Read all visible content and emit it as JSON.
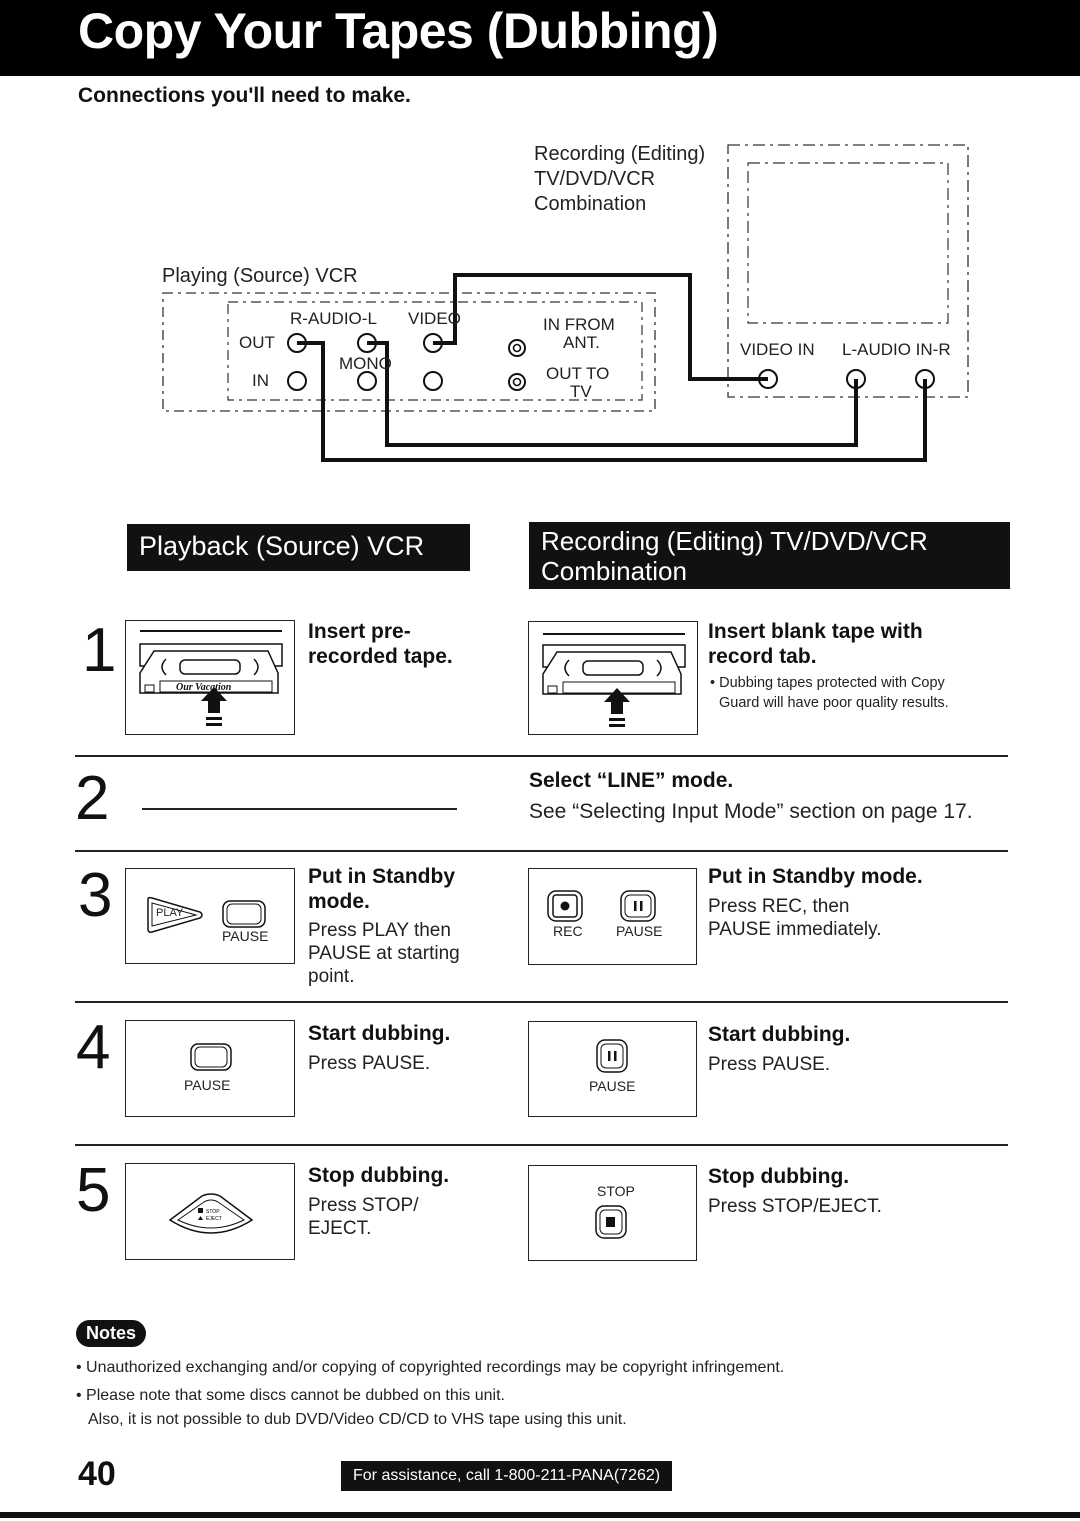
{
  "header": {
    "title": "Copy Your Tapes (Dubbing)",
    "subtitle": "Connections you'll need to make."
  },
  "diagram": {
    "source_device_label": "Playing (Source) VCR",
    "target_device_label_lines": [
      "Recording (Editing)",
      "TV/DVD/VCR",
      "Combination"
    ],
    "source_jacks": {
      "audio_label": "R-AUDIO-L",
      "video_label": "VIDEO",
      "out_label": "OUT",
      "in_label": "IN",
      "mono_label": "MONO",
      "in_from_label": "IN FROM",
      "ant_label": "ANT.",
      "out_to_label": "OUT TO",
      "tv_label": "TV"
    },
    "target_jacks": {
      "video_in_label": "VIDEO IN",
      "audio_in_label": "L-AUDIO IN-R"
    }
  },
  "columns": {
    "left_heading": "Playback (Source) VCR",
    "right_heading_lines": [
      "Recording (Editing) TV/DVD/VCR",
      "Combination"
    ]
  },
  "steps": [
    {
      "number": "1",
      "left": {
        "heading": "Insert pre-\nrecorded tape.",
        "heading_lines": [
          "Insert pre-",
          "recorded tape."
        ],
        "tape_label": "Our Vacation"
      },
      "right": {
        "heading_lines": [
          "Insert blank tape with",
          "record tab."
        ],
        "bullet_lines": [
          "• Dubbing tapes protected with Copy",
          "  Guard will have poor quality results."
        ]
      }
    },
    {
      "number": "2",
      "right": {
        "heading": "Select “LINE” mode.",
        "text": "See “Selecting Input Mode” section on page 17."
      }
    },
    {
      "number": "3",
      "left": {
        "heading_lines": [
          "Put in Standby",
          "mode."
        ],
        "text_lines": [
          "Press PLAY then",
          "PAUSE at starting",
          "point."
        ],
        "buttons": [
          "PLAY",
          "PAUSE"
        ]
      },
      "right": {
        "heading": "Put in Standby mode.",
        "text_lines": [
          "Press REC, then",
          "PAUSE immediately."
        ],
        "buttons": [
          "REC",
          "PAUSE"
        ]
      }
    },
    {
      "number": "4",
      "left": {
        "heading": "Start dubbing.",
        "text": "Press PAUSE.",
        "buttons": [
          "PAUSE"
        ]
      },
      "right": {
        "heading": "Start dubbing.",
        "text": "Press PAUSE.",
        "buttons": [
          "PAUSE"
        ]
      }
    },
    {
      "number": "5",
      "left": {
        "heading": "Stop dubbing.",
        "text_lines": [
          "Press STOP/",
          "EJECT."
        ],
        "buttons": [
          "STOP",
          "EJECT"
        ]
      },
      "right": {
        "heading": "Stop dubbing.",
        "text": "Press STOP/EJECT.",
        "buttons": [
          "STOP"
        ]
      }
    }
  ],
  "notes": {
    "badge": "Notes",
    "items": [
      "• Unauthorized exchanging and/or copying of copyrighted recordings may be copyright infringement.",
      "• Please note that some discs cannot be dubbed on this unit."
    ],
    "continuation": "Also, it is not possible to dub DVD/Video CD/CD to VHS tape using this unit."
  },
  "footer": {
    "page_number": "40",
    "assistance": "For assistance, call 1-800-211-PANA(7262)"
  }
}
